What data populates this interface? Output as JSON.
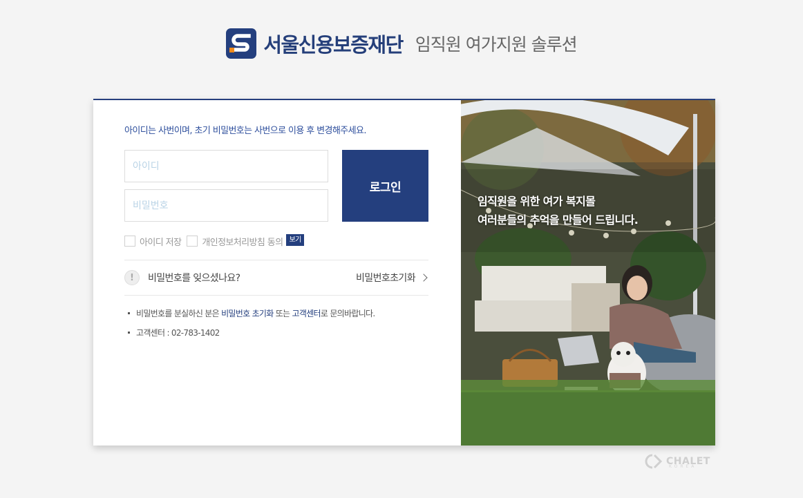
{
  "header": {
    "logo_letter": "S",
    "brand": "서울신용보증재단",
    "subtitle": "임직원 여가지원 솔루션"
  },
  "login": {
    "notice": "아이디는 사번이며, 초기 비밀번호는 사번으로 이용 후 변경해주세요.",
    "id_placeholder": "아이디",
    "id_value": "",
    "pw_placeholder": "비밀번호",
    "pw_value": "",
    "button_label": "로그인",
    "save_id_label": "아이디 저장",
    "privacy_label": "개인정보처리방침 동의",
    "privacy_view_label": "보기"
  },
  "forgot": {
    "icon_symbol": "!",
    "question": "비밀번호를 잊으셨나요?",
    "reset_link": "비밀번호초기화"
  },
  "help": {
    "line1_a": "비밀번호를 분실하신 분은 ",
    "line1_hl1": "비밀번호 초기화",
    "line1_b": " 또는 ",
    "line1_hl2": "고객센터",
    "line1_c": "로 문의바랍니다.",
    "line2": "고객센터 : 02-783-1402"
  },
  "banner": {
    "line1": "임직원을 위한 여가 복지몰",
    "line2": "여러분들의 추억을 만들어 드립니다."
  },
  "footer": {
    "watermark": "CHALET",
    "watermark_sub": "KOREA"
  },
  "colors": {
    "brand_navy": "#243f7e",
    "notice_blue": "#2d4e9c",
    "logo_orange": "#f08a1c"
  }
}
